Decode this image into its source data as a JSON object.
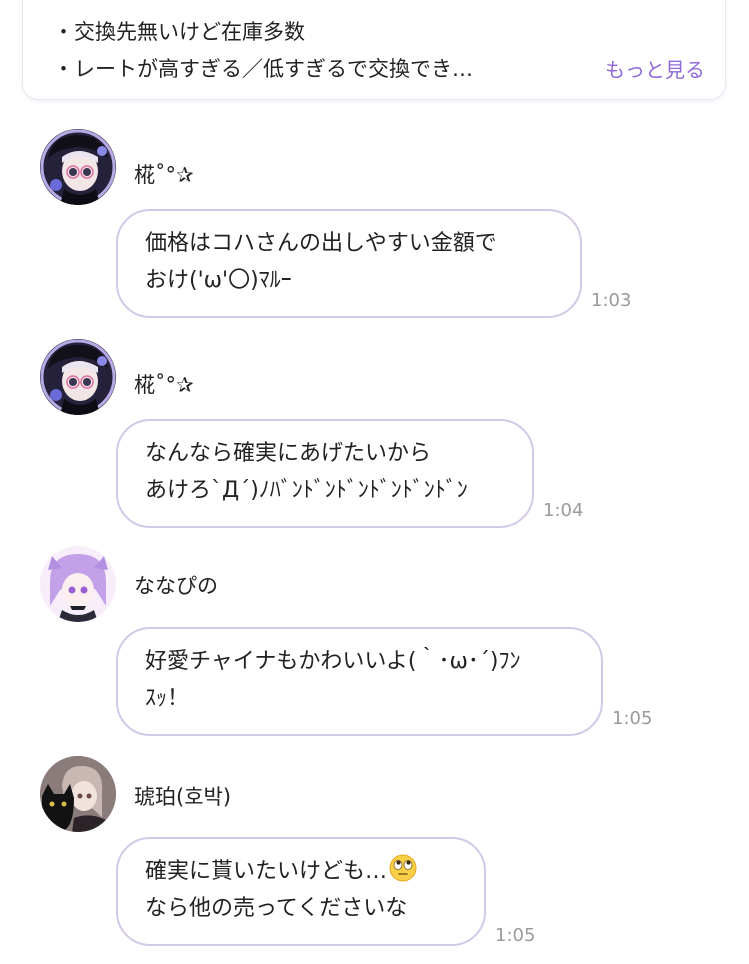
{
  "notice": {
    "line1": "・交換先無いけど在庫多数",
    "line2": "・レートが高すぎる／低すぎるで交換でき…",
    "more_label": "もっと見る"
  },
  "messages": [
    {
      "sender": "椛˚°✰",
      "lines": [
        "価格はコハさんの出しやすい金額で",
        "おけ('ω'〇)ﾏﾙｰ"
      ],
      "time": "1:03",
      "avatar_icon": "avatar-girl-dark-hair-icon"
    },
    {
      "sender": "椛˚°✰",
      "lines": [
        "なんなら確実にあげたいから",
        "あけろ`Д´)ﾉﾊﾞﾝﾄﾞﾝﾄﾞﾝﾄﾞﾝﾄﾞﾝﾄﾞﾝ"
      ],
      "time": "1:04",
      "avatar_icon": "avatar-girl-dark-hair-icon"
    },
    {
      "sender": "ななぴの",
      "lines": [
        "好愛チャイナもかわいいよ(｀･ω･´)ﾌﾝ",
        "ｽｯ！"
      ],
      "time": "1:05",
      "avatar_icon": "avatar-girl-purple-hair-icon"
    },
    {
      "sender": "琥珀(호박)",
      "lines": [
        "確実に貰いたいけども…",
        "なら他の売ってくださいな"
      ],
      "time": "1:05",
      "avatar_icon": "avatar-girl-with-black-cat-icon",
      "emoji": "face-with-rolling-eyes-icon"
    }
  ],
  "colors": {
    "bubble_border": "#d3c8e6",
    "accent_link": "#8f6ad8",
    "timestamp": "#9a9a9a"
  }
}
